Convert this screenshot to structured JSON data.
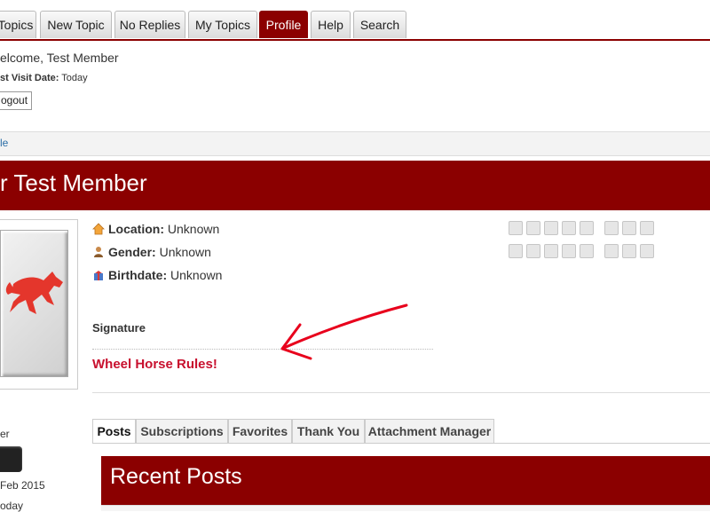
{
  "nav": {
    "tabs": [
      {
        "label": "Topics",
        "active": false
      },
      {
        "label": "New Topic",
        "active": false
      },
      {
        "label": "No Replies",
        "active": false
      },
      {
        "label": "My Topics",
        "active": false
      },
      {
        "label": "Profile",
        "active": true
      },
      {
        "label": "Help",
        "active": false
      },
      {
        "label": "Search",
        "active": false
      }
    ]
  },
  "header": {
    "welcome_prefix": "elcome,",
    "username": "Test Member",
    "last_visit_label": "st Visit Date:",
    "last_visit_value": "Today",
    "logout_label": "ogout"
  },
  "breadcrumb": {
    "text": "le"
  },
  "banner": {
    "title": "r Test Member"
  },
  "profile": {
    "location_label": "Location:",
    "location_value": "Unknown",
    "gender_label": "Gender:",
    "gender_value": "Unknown",
    "birthdate_label": "Birthdate:",
    "birthdate_value": "Unknown",
    "signature_label": "Signature",
    "signature_text": "Wheel Horse Rules!"
  },
  "sidebar": {
    "rank_fragment": "er",
    "registered_fragment": "Feb 2015",
    "last_visit_fragment": "oday"
  },
  "profile_tabs": [
    {
      "label": "Posts",
      "active": true
    },
    {
      "label": "Subscriptions",
      "active": false
    },
    {
      "label": "Favorites",
      "active": false
    },
    {
      "label": "Thank You",
      "active": false
    },
    {
      "label": "Attachment Manager",
      "active": false
    }
  ],
  "recent": {
    "title": "Recent Posts"
  },
  "colors": {
    "brand": "#8b0000",
    "signature": "#c8102e",
    "annotation_arrow": "#e8001c"
  },
  "icons": {
    "location": "home-icon",
    "gender": "person-icon",
    "birthdate": "gift-icon",
    "social_row1": [
      "twitter-icon",
      "facebook-icon",
      "myspace-icon",
      "linkedin-icon",
      "skype-icon",
      "delicious-icon",
      "friendfeed-icon",
      "digg-icon"
    ],
    "social_row2": [
      "mail-icon",
      "aim-icon",
      "yahoo-icon",
      "icq-icon",
      "vk-icon",
      "blogspot-icon",
      "flickr-icon",
      "bebo-icon"
    ]
  }
}
